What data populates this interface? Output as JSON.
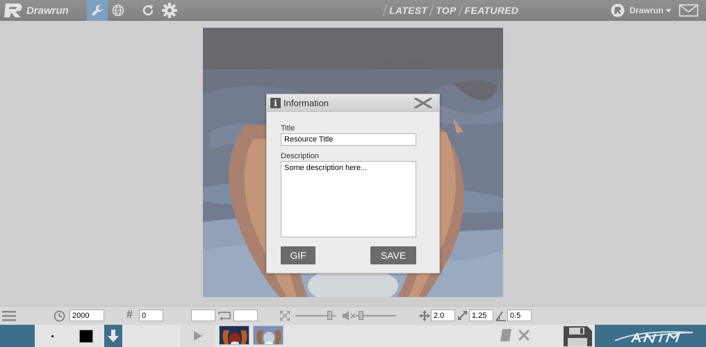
{
  "app": {
    "name": "Drawrun"
  },
  "nav": {
    "latest": "LATEST",
    "top": "TOP",
    "featured": "FEATURED"
  },
  "user": {
    "name": "Drawrun"
  },
  "dialog": {
    "title": "Information",
    "title_label": "Title",
    "title_value": "Resource Title",
    "description_label": "Description",
    "description_value": "Some description here...",
    "gif_label": "GIF",
    "save_label": "SAVE"
  },
  "toolbar": {
    "duration": "2000",
    "frame_number": "0",
    "loop_start": "",
    "loop_end": "",
    "move_value": "2.0",
    "scale_value": "1.25",
    "skew_value": "0.5"
  },
  "colors": {
    "accent": "#2f78b8",
    "topbar": "#3b3b3b",
    "bottombar": "#3e6f8a",
    "canvas": "#1c2a4d"
  }
}
